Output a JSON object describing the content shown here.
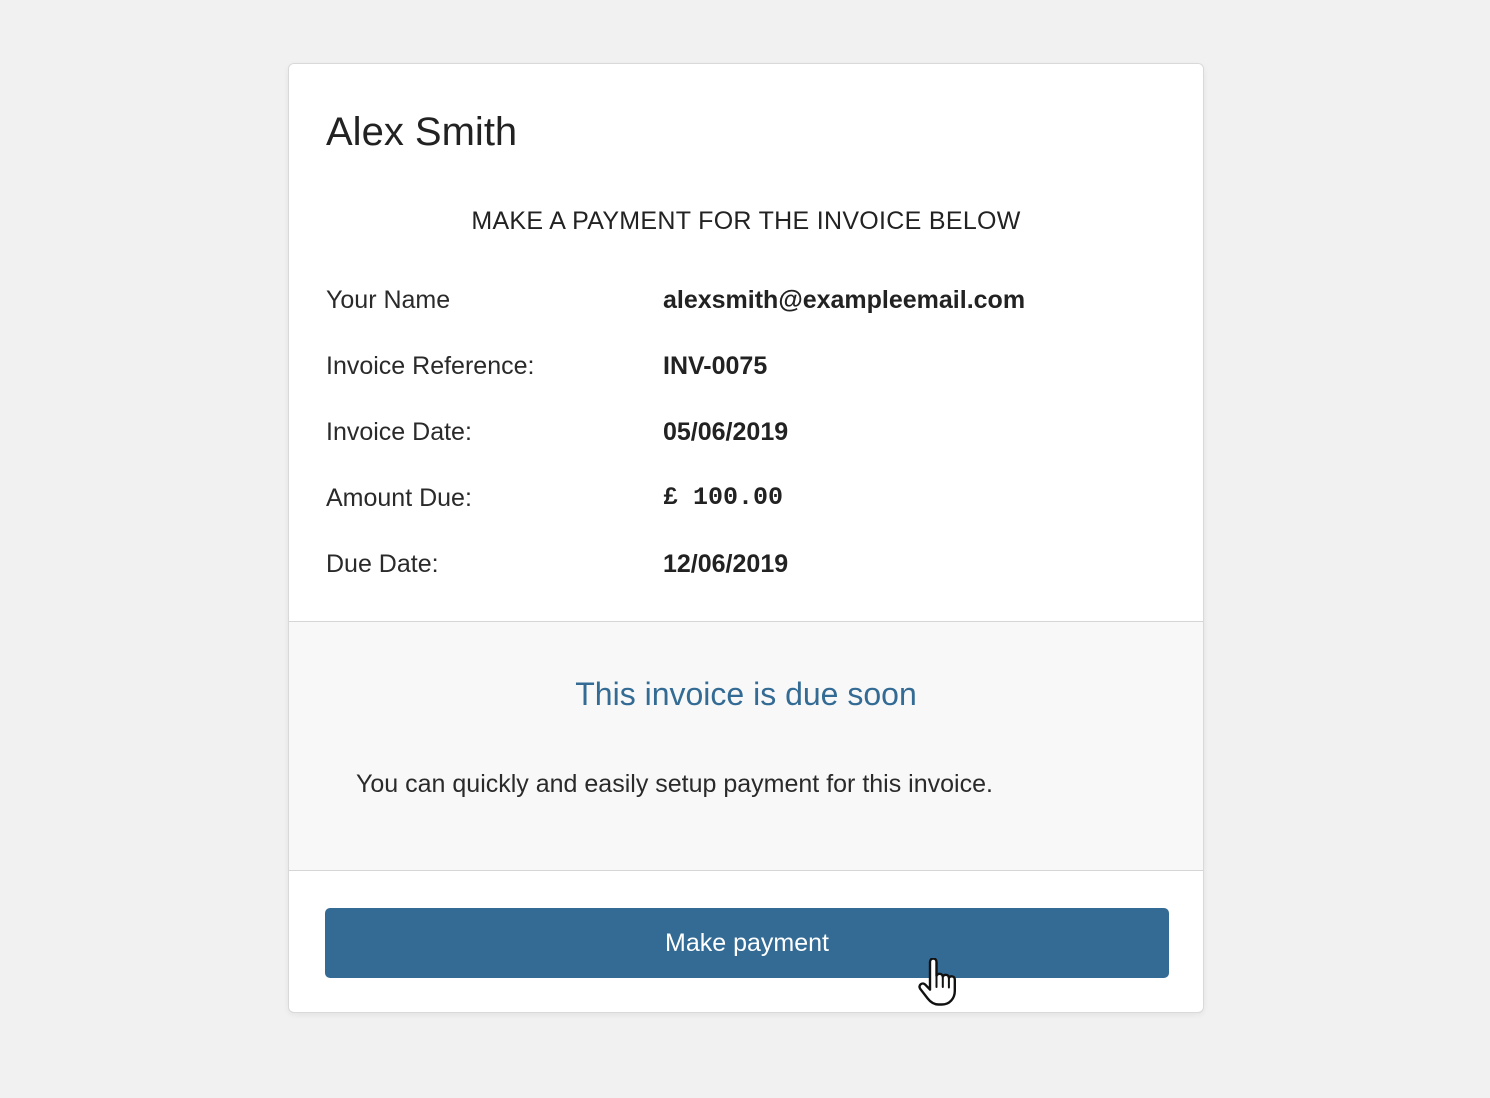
{
  "customer": {
    "name": "Alex Smith"
  },
  "heading": "MAKE A PAYMENT FOR THE INVOICE BELOW",
  "details": [
    {
      "label": "Your Name",
      "value": "alexsmith@exampleemail.com"
    },
    {
      "label": "Invoice Reference:",
      "value": "INV-0075"
    },
    {
      "label": "Invoice Date:",
      "value": "05/06/2019"
    },
    {
      "label": "Amount Due:",
      "value": "£ 100.00"
    },
    {
      "label": "Due Date:",
      "value": "12/06/2019"
    }
  ],
  "notice": {
    "title": "This invoice is due soon",
    "text": "You can quickly and easily setup payment for this invoice."
  },
  "action": {
    "button_label": "Make payment"
  },
  "colors": {
    "accent": "#336b94",
    "background": "#f1f1f1",
    "notice_background": "#f8f8f8"
  },
  "icons": {
    "cursor": "hand-pointer-icon"
  }
}
